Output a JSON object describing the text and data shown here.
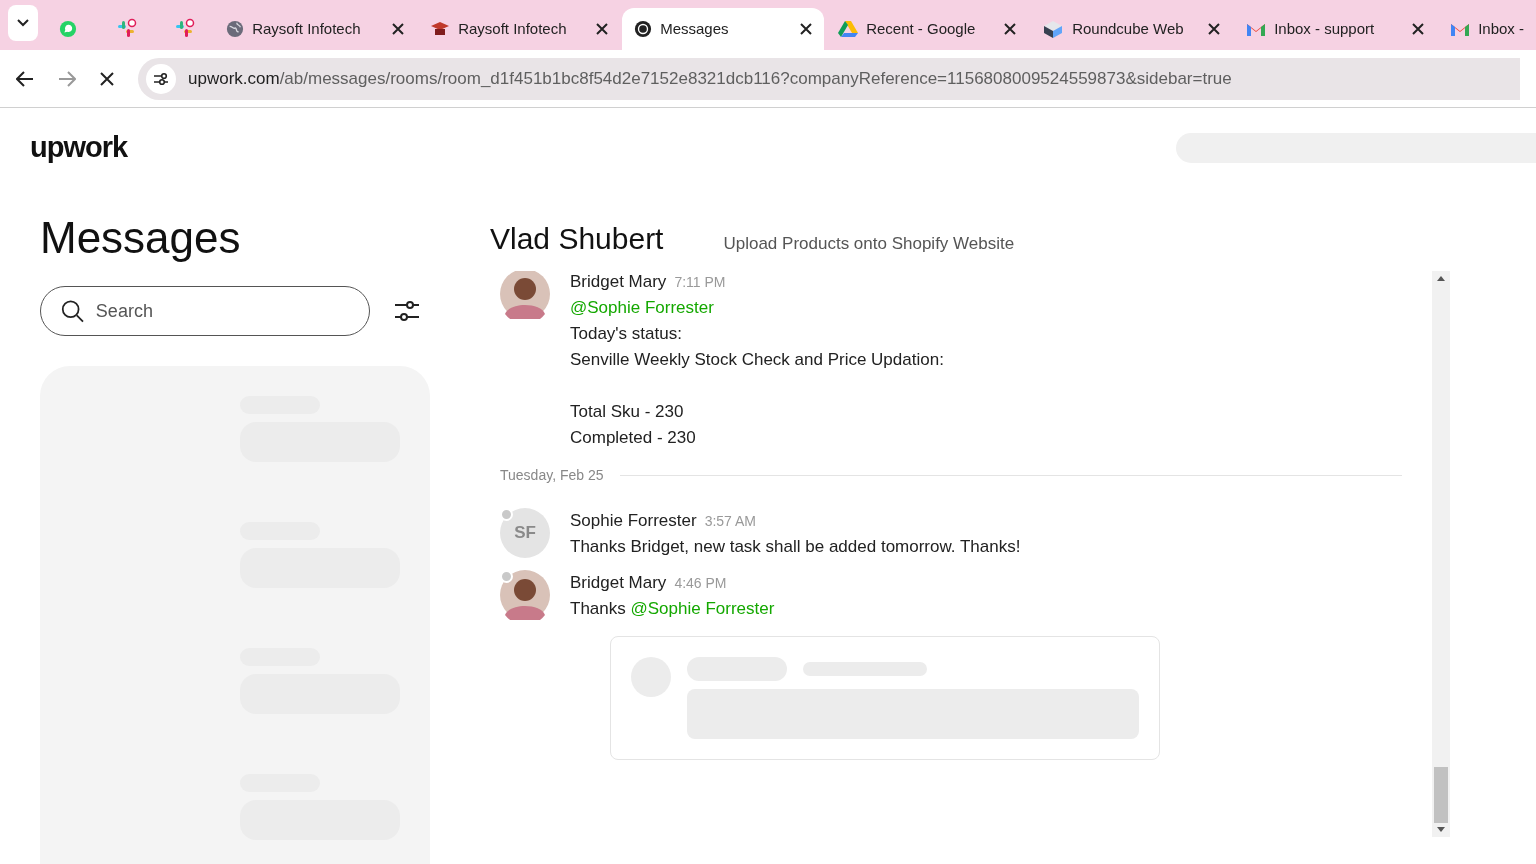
{
  "browser": {
    "tabs": [
      {
        "kind": "whatsapp",
        "selected": false
      },
      {
        "kind": "slack",
        "selected": false
      },
      {
        "kind": "slack",
        "selected": false
      },
      {
        "kind": "globe",
        "label": "Raysoft Infotech",
        "selected": false,
        "closable": true
      },
      {
        "kind": "hat",
        "label": "Raysoft Infotech",
        "selected": false,
        "closable": true
      },
      {
        "kind": "upwork",
        "label": "Messages",
        "selected": true,
        "closable": true
      },
      {
        "kind": "drive",
        "label": "Recent - Google",
        "selected": false,
        "closable": true
      },
      {
        "kind": "cube",
        "label": "Roundcube Web",
        "selected": false,
        "closable": true
      },
      {
        "kind": "gmail",
        "label": "Inbox - support",
        "selected": false,
        "closable": true
      },
      {
        "kind": "gmail",
        "label": "Inbox -",
        "selected": false,
        "closable": false
      }
    ],
    "url_host": "upwork.com",
    "url_path": "/ab/messages/rooms/room_d1f451b1bc8f54d2e7152e8321dcb116?companyReference=1156808009524559873&sidebar=true",
    "loading": true
  },
  "logo": "upwork",
  "sidebar": {
    "title": "Messages",
    "search": {
      "placeholder": "Search"
    }
  },
  "conversation": {
    "name": "Vlad Shubert",
    "subject": "Upload Products onto Shopify Website",
    "items": [
      {
        "kind": "message",
        "author": "Bridget Mary",
        "time": "7:11 PM",
        "avatar": {
          "kind": "photo"
        },
        "status_dot": false,
        "lines": [
          {
            "spaced_before": false,
            "parts": [
              {
                "text": "@Sophie Forrester",
                "mention": true
              }
            ]
          },
          {
            "spaced_before": false,
            "parts": [
              {
                "text": "Today's status:",
                "mention": false
              }
            ]
          },
          {
            "spaced_before": false,
            "parts": [
              {
                "text": "Senville Weekly Stock Check and Price Updation:",
                "mention": false
              }
            ]
          },
          {
            "spaced_before": true,
            "parts": [
              {
                "text": "Total Sku - 230",
                "mention": false
              }
            ]
          },
          {
            "spaced_before": false,
            "parts": [
              {
                "text": "Completed - 230",
                "mention": false
              }
            ]
          }
        ]
      },
      {
        "kind": "date",
        "label": "Tuesday, Feb 25"
      },
      {
        "kind": "message",
        "author": "Sophie Forrester",
        "time": "3:57 AM",
        "avatar": {
          "kind": "initials",
          "initials": "SF"
        },
        "status_dot": true,
        "lines": [
          {
            "spaced_before": false,
            "parts": [
              {
                "text": "Thanks Bridget, new task shall be added tomorrow. Thanks!",
                "mention": false
              }
            ]
          }
        ]
      },
      {
        "kind": "message",
        "author": "Bridget Mary",
        "time": "4:46 PM",
        "avatar": {
          "kind": "photo"
        },
        "status_dot": true,
        "lines": [
          {
            "spaced_before": false,
            "parts": [
              {
                "text": "Thanks ",
                "mention": false
              },
              {
                "text": "@Sophie Forrester",
                "mention": true
              }
            ]
          }
        ]
      }
    ]
  }
}
